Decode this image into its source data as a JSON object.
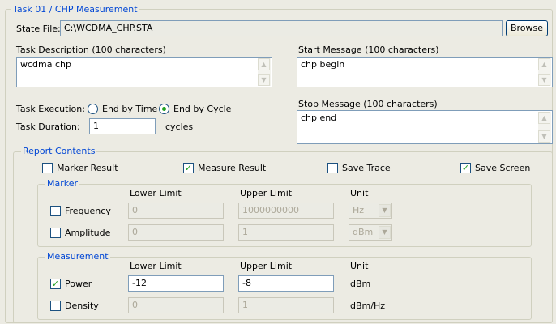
{
  "task_group": {
    "title": "Task 01 / CHP Measurement"
  },
  "state_file": {
    "label": "State File:",
    "value": "C:\\WCDMA_CHP.STA",
    "browse_label": "Browse"
  },
  "task_description": {
    "label": "Task Description (100 characters)",
    "value": "wcdma chp"
  },
  "start_message": {
    "label": "Start Message (100 characters)",
    "value": "chp begin"
  },
  "stop_message": {
    "label": "Stop Message (100 characters)",
    "value": "chp end"
  },
  "task_execution": {
    "label": "Task Execution:",
    "options": [
      {
        "label": "End by Time",
        "selected": false
      },
      {
        "label": "End by Cycle",
        "selected": true
      }
    ]
  },
  "task_duration": {
    "label": "Task Duration:",
    "value": "1",
    "unit": "cycles"
  },
  "report_contents": {
    "title": "Report Contents",
    "checks": [
      {
        "label": "Marker Result",
        "checked": false
      },
      {
        "label": "Measure Result",
        "checked": true
      },
      {
        "label": "Save Trace",
        "checked": false
      },
      {
        "label": "Save Screen",
        "checked": true
      }
    ]
  },
  "marker": {
    "title": "Marker",
    "headers": {
      "lower": "Lower Limit",
      "upper": "Upper Limit",
      "unit": "Unit"
    },
    "rows": [
      {
        "label": "Frequency",
        "checked": false,
        "lower": "0",
        "upper": "1000000000",
        "unit": "Hz"
      },
      {
        "label": "Amplitude",
        "checked": false,
        "lower": "0",
        "upper": "1",
        "unit": "dBm"
      }
    ]
  },
  "measurement": {
    "title": "Measurement",
    "headers": {
      "lower": "Lower Limit",
      "upper": "Upper Limit",
      "unit": "Unit"
    },
    "rows": [
      {
        "label": "Power",
        "checked": true,
        "lower": "-12",
        "upper": "-8",
        "unit": "dBm"
      },
      {
        "label": "Density",
        "checked": false,
        "lower": "0",
        "upper": "1",
        "unit": "dBm/Hz"
      }
    ]
  },
  "icons": {
    "check": "check-mark-icon",
    "scroll_up": "arrow-up-icon",
    "scroll_down": "arrow-down-icon",
    "dropdown": "chevron-down-icon"
  }
}
